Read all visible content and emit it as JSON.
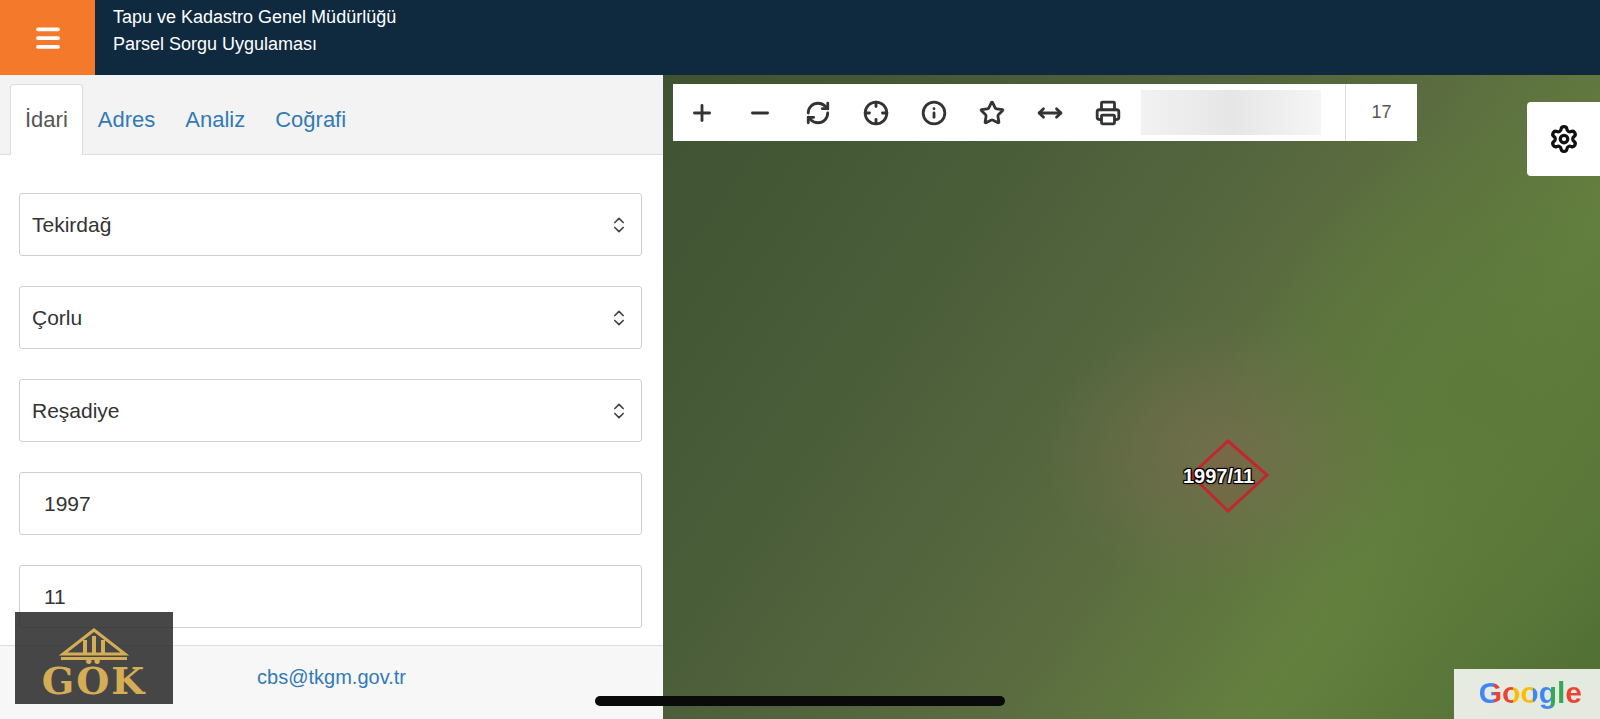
{
  "header": {
    "title": "Tapu ve Kadastro Genel Müdürlüğü",
    "subtitle": "Parsel Sorgu Uygulaması"
  },
  "tabs": [
    {
      "label": "İdari",
      "selected": true
    },
    {
      "label": "Adres",
      "selected": false
    },
    {
      "label": "Analiz",
      "selected": false
    },
    {
      "label": "Coğrafi",
      "selected": false
    }
  ],
  "fields": [
    {
      "kind": "select",
      "value": "Tekirdağ"
    },
    {
      "kind": "select",
      "value": "Çorlu"
    },
    {
      "kind": "select",
      "value": "Reşadiye"
    },
    {
      "kind": "input",
      "value": "1997"
    },
    {
      "kind": "input",
      "value": "11"
    }
  ],
  "footer": {
    "email": "cbs@tkgm.gov.tr"
  },
  "logo": {
    "text": "GÖK"
  },
  "map": {
    "zoom": "17",
    "search": {
      "value": ""
    },
    "parcel": {
      "label": "1997/11"
    },
    "attribution": "Google"
  }
}
